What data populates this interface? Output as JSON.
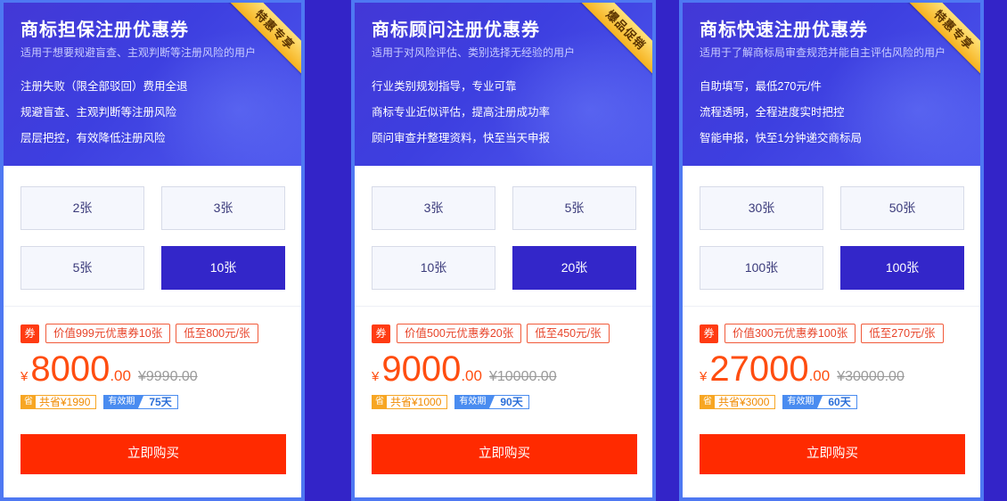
{
  "cards": [
    {
      "title": "商标顾问注册优惠券",
      "subtitle": "适用于对风险评估、类别选择无经验的用户",
      "ribbon": "爆品促销",
      "features": [
        "行业类别规划指导，专业可靠",
        "商标专业近似评估，提高注册成功率",
        "顾问审查并整理资料，快至当天申报"
      ],
      "options": [
        "3张",
        "5张",
        "10张",
        "20张"
      ],
      "selected_option": "20张",
      "coupon_badge": "券",
      "coupon_tags": [
        "价值500元优惠券20张",
        "低至450元/张"
      ],
      "currency": "¥",
      "price_main": "9000",
      "price_dec": ".00",
      "price_orig": "¥10000.00",
      "save_badge": "省",
      "save_text": "共省¥1000",
      "validity_label": "有效期",
      "validity_value": "90天",
      "buy_label": "立即购买"
    },
    {
      "title": "商标快速注册优惠券",
      "subtitle": "适用于了解商标局审查规范并能自主评估风险的用户",
      "ribbon": "特惠专享",
      "features": [
        "自助填写，最低270元/件",
        "流程透明，全程进度实时把控",
        "智能申报，快至1分钟递交商标局"
      ],
      "options": [
        "30张",
        "50张",
        "100张",
        "100张"
      ],
      "selected_option": "100张",
      "coupon_badge": "券",
      "coupon_tags": [
        "价值300元优惠券100张",
        "低至270元/张"
      ],
      "currency": "¥",
      "price_main": "27000",
      "price_dec": ".00",
      "price_orig": "¥30000.00",
      "save_badge": "省",
      "save_text": "共省¥3000",
      "validity_label": "有效期",
      "validity_value": "60天",
      "buy_label": "立即购买"
    },
    {
      "title": "商标担保注册优惠券",
      "subtitle": "适用于想要规避盲查、主观判断等注册风险的用户",
      "ribbon": "特惠专享",
      "features": [
        "注册失败（限全部驳回）费用全退",
        "规避盲查、主观判断等注册风险",
        "层层把控，有效降低注册风险"
      ],
      "options": [
        "2张",
        "3张",
        "5张",
        "10张"
      ],
      "selected_option": "10张",
      "coupon_badge": "券",
      "coupon_tags": [
        "价值999元优惠券10张",
        "低至800元/张"
      ],
      "currency": "¥",
      "price_main": "8000",
      "price_dec": ".00",
      "price_orig": "¥9990.00",
      "save_badge": "省",
      "save_text": "共省¥1990",
      "validity_label": "有效期",
      "validity_value": "75天",
      "buy_label": "立即购买"
    }
  ],
  "colors": {
    "background": "#3324c8",
    "selected_option": "#3326c9",
    "price": "#ff4d10",
    "buy_button": "#ff2a00"
  }
}
